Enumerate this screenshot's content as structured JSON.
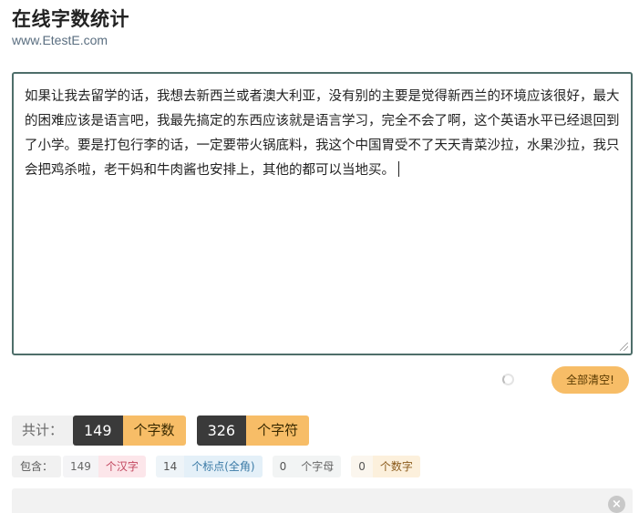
{
  "header": {
    "title": "在线字数统计",
    "site": "www.EtestE.com"
  },
  "editor": {
    "text": "如果让我去留学的话，我想去新西兰或者澳大利亚，没有别的主要是觉得新西兰的环境应该很好，最大的困难应该是语言吧，我最先搞定的东西应该就是语言学习，完全不会了啊，这个英语水平已经退回到了小学。要是打包行李的话，一定要带火锅底料，我这个中国胃受不了天天青菜沙拉，水果沙拉，我只会把鸡杀啦，老干妈和牛肉酱也安排上，其他的都可以当地买。"
  },
  "actions": {
    "clear_label": "全部清空!"
  },
  "totals": {
    "label": "共计：",
    "words_value": "149",
    "words_unit": "个字数",
    "chars_value": "326",
    "chars_unit": "个字符"
  },
  "breakdown": {
    "label": "包含：",
    "hanzi_value": "149",
    "hanzi_unit": "个汉字",
    "punct_value": "14",
    "punct_unit": "个标点(全角)",
    "letters_value": "0",
    "letters_unit": "个字母",
    "digits_value": "0",
    "digits_unit": "个数字"
  },
  "colors": {
    "accent": "#f7bd67",
    "dark": "#3a3a3a",
    "editor_border": "#4e6e6a"
  },
  "icons": {
    "loading": "spinner-icon",
    "close": "close-icon"
  }
}
